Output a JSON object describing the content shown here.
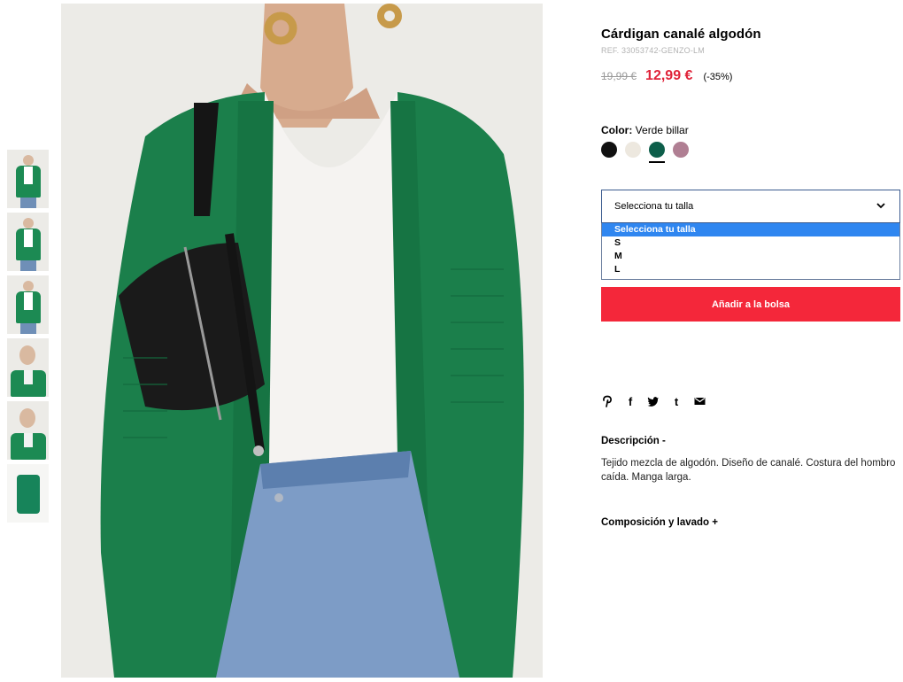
{
  "thumbnails": [
    {
      "name": "thumb-1"
    },
    {
      "name": "thumb-2"
    },
    {
      "name": "thumb-3"
    },
    {
      "name": "thumb-4"
    },
    {
      "name": "thumb-5"
    },
    {
      "name": "thumb-6"
    }
  ],
  "product": {
    "title": "Cárdigan canalé algodón",
    "ref": "REF. 33053742-GENZO-LM",
    "old_price": "19,99 €",
    "new_price": "12,99 €",
    "discount": "(-35%)"
  },
  "color": {
    "label": "Color:",
    "value": "Verde billar",
    "swatches": [
      {
        "name": "black",
        "hex": "#111111"
      },
      {
        "name": "cream",
        "hex": "#ede8df"
      },
      {
        "name": "green",
        "hex": "#0d5e4a",
        "selected": true
      },
      {
        "name": "mauve",
        "hex": "#b07f93"
      }
    ]
  },
  "size": {
    "selected": "Selecciona tu talla",
    "options": [
      "Selecciona tu talla",
      "S",
      "M",
      "L"
    ]
  },
  "add_to_bag": "Añadir a la bolsa",
  "social": {
    "pinterest": "P",
    "facebook": "f",
    "twitter": "t",
    "tumblr": "t"
  },
  "description": {
    "heading": "Descripción -",
    "text": "Tejido mezcla de algodón. Diseño de canalé. Costura del hombro caída. Manga larga."
  },
  "composition": {
    "heading": "Composición y lavado +"
  },
  "colors": {
    "price_red": "#e0243a",
    "button_red": "#f4273a",
    "cardigan_green": "#1b7f4b"
  }
}
